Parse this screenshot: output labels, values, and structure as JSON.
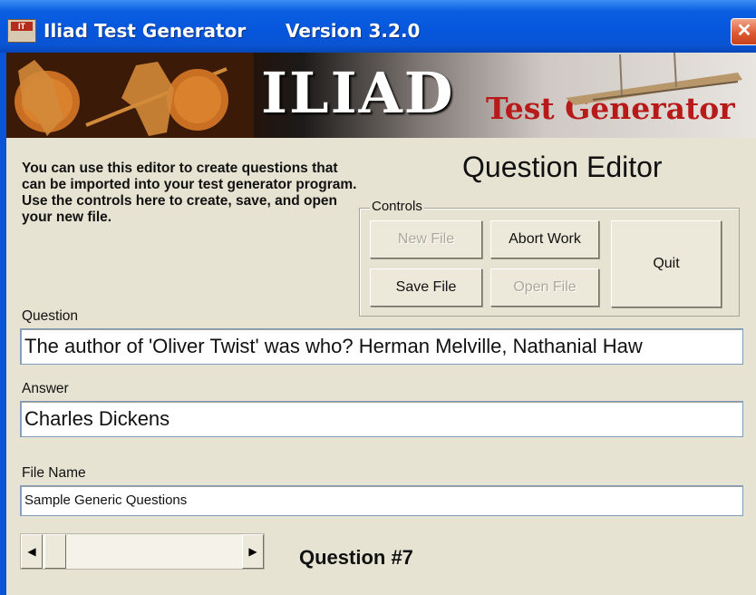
{
  "window": {
    "title": "Iliad Test Generator",
    "version": "Version 3.2.0",
    "close_glyph": "✕",
    "icon_text": "IT"
  },
  "banner": {
    "logo": "ILIAD",
    "subtitle": "Test Generator"
  },
  "intro_text": "You can use this editor to create questions that can be imported into your test generator program.  Use the controls here to create, save, and open your new file.",
  "editor_title": "Question Editor",
  "controls": {
    "legend": "Controls",
    "new_file": "New File",
    "abort_work": "Abort Work",
    "quit": "Quit",
    "save_file": "Save File",
    "open_file": "Open File"
  },
  "question": {
    "label": "Question",
    "value": "The author of 'Oliver Twist' was who? Herman Melville, Nathanial Haw"
  },
  "answer": {
    "label": "Answer",
    "value": "Charles Dickens"
  },
  "file_name": {
    "label": "File Name",
    "value": "Sample Generic Questions"
  },
  "navigator": {
    "left_arrow": "◀",
    "right_arrow": "▶",
    "question_number": "Question #7"
  },
  "colors": {
    "titlebar": "#0656dc",
    "face": "#e7e3d2",
    "banner_subtitle": "#b81a1a",
    "close": "#de5a32"
  }
}
